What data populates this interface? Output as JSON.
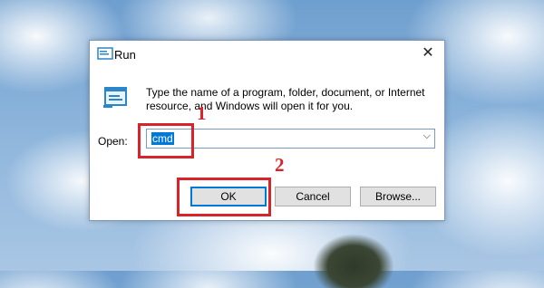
{
  "dialog": {
    "title": "Run",
    "close_glyph": "✕",
    "description": "Type the name of a program, folder, document, or Internet resource, and Windows will open it for you.",
    "open_label": "Open:",
    "open_value": "cmd",
    "dropdown_glyph": "⌵",
    "buttons": {
      "ok": "OK",
      "cancel": "Cancel",
      "browse": "Browse..."
    },
    "icons": [
      "run-icon",
      "run-large-icon",
      "close-icon",
      "chevron-down-icon"
    ]
  },
  "annotations": {
    "step1": "1",
    "step2": "2",
    "color": "#d8232a"
  },
  "colors": {
    "accent": "#0078d7",
    "button_bg": "#e1e1e1"
  }
}
